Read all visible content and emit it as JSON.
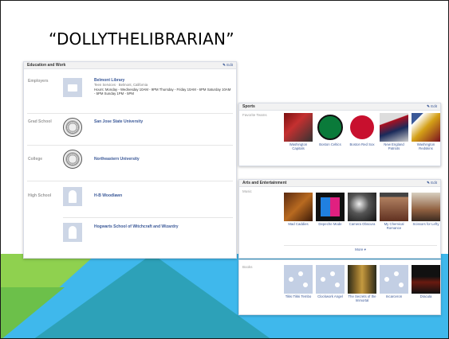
{
  "slide": {
    "title": "“DOLLYTHELIBRARIAN”"
  },
  "colors": {
    "link": "#3b5998",
    "bg_blue": "#3fb8ec",
    "bg_green": "#8fd14f",
    "bg_teal": "#2b9fb3"
  },
  "education": {
    "header": "Education and Work",
    "edit_label": "Edit",
    "employers_label": "Employers",
    "employer_name": "Belmont Library",
    "employer_sub": "Teen Services · Belmont, California",
    "employer_hours": "Hours: Monday - Wednesday 10AM - 9PM Thursday - Friday 10AM - 6PM Saturday 10AM - 5PM Sunday 1PM - 5PM",
    "grad_label": "Grad School",
    "grad_name": "San Jose State University",
    "college_label": "College",
    "college_name": "Northeastern University",
    "hs_label": "High School",
    "hs_name1": "H-B Woodlawn",
    "hs_name2": "Hogwarts School of Witchcraft and Wizardry"
  },
  "sports": {
    "header": "Sports",
    "edit_label": "Edit",
    "label": "Favorite Teams",
    "teams": [
      "Washington Capitals",
      "Boston Celtics",
      "Boston Red Sox",
      "New England Patriots",
      "Washington Redskins"
    ]
  },
  "arts": {
    "header": "Arts and Entertainment",
    "edit_label": "Edit",
    "music_label": "Music",
    "music": [
      "Mad Caddies",
      "Depeche Mode",
      "Camera Obscura",
      "My Chemical Romance",
      "Scissors for Lefty"
    ],
    "more_label": "More ▾"
  },
  "books": {
    "label": "Books",
    "items": [
      "Tikki Tikki Tembo",
      "Clockwork Angel",
      "The Secrets of the Immortal",
      "Incarceron",
      "Dracula"
    ]
  }
}
